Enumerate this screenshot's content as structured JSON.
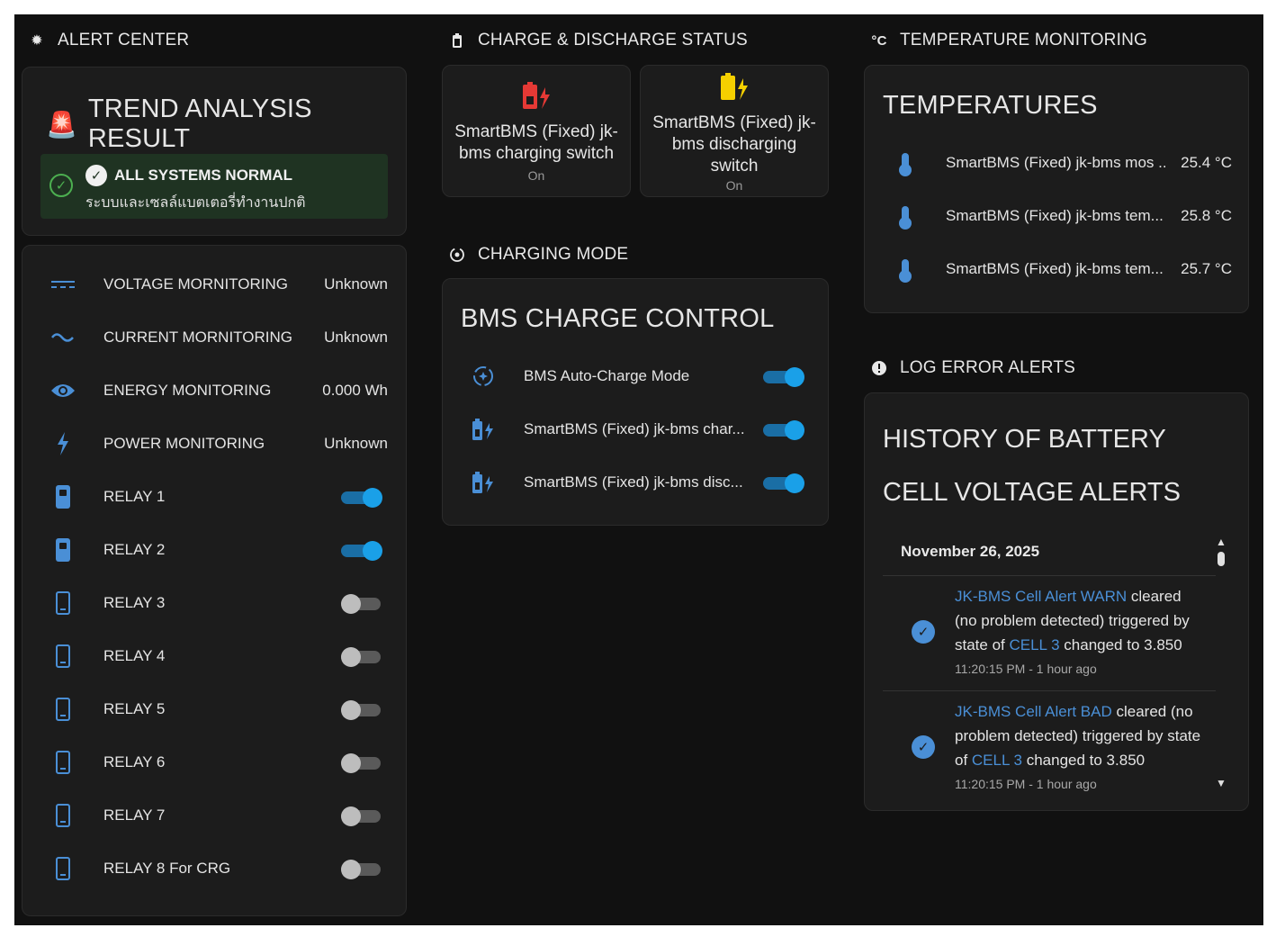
{
  "alert_center": {
    "title": "ALERT CENTER",
    "trend_title": "TREND ANALYSIS RESULT",
    "status_title": "ALL SYSTEMS NORMAL",
    "status_sub": "ระบบและเซลล์แบตเตอรี่ทำงานปกติ",
    "status_color": "#1f3322",
    "monitors": [
      {
        "label": "VOLTAGE MORNITORING",
        "value": "Unknown",
        "icon": "voltage-icon"
      },
      {
        "label": "CURRENT MORNITORING",
        "value": "Unknown",
        "icon": "current-icon"
      },
      {
        "label": "ENERGY MONITORING",
        "value": "0.000 Wh",
        "icon": "eye-icon"
      },
      {
        "label": "POWER MONITORING",
        "value": "Unknown",
        "icon": "lightning-icon"
      }
    ],
    "relays": [
      {
        "label": "RELAY 1",
        "on": true
      },
      {
        "label": "RELAY 2",
        "on": true
      },
      {
        "label": "RELAY 3",
        "on": false
      },
      {
        "label": "RELAY 4",
        "on": false
      },
      {
        "label": "RELAY 5",
        "on": false
      },
      {
        "label": "RELAY 6",
        "on": false
      },
      {
        "label": "RELAY 7",
        "on": false
      },
      {
        "label": "RELAY 8 For CRG",
        "on": false
      }
    ]
  },
  "charge_status": {
    "title": "CHARGE & DISCHARGE STATUS",
    "tiles": [
      {
        "name": "SmartBMS (Fixed) jk-bms charging switch",
        "state": "On",
        "icon": "battery-charging-icon",
        "color": "#e53935"
      },
      {
        "name": "SmartBMS (Fixed) jk-bms discharging switch",
        "state": "On",
        "icon": "battery-discharging-icon",
        "color": "#f5d000"
      }
    ]
  },
  "charging_mode": {
    "title": "CHARGING MODE",
    "card_title": "BMS CHARGE CONTROL",
    "rows": [
      {
        "label": "BMS Auto-Charge Mode",
        "icon": "auto-mode-icon",
        "on": true
      },
      {
        "label": "SmartBMS (Fixed) jk-bms char...",
        "icon": "battery-charging-icon",
        "on": true
      },
      {
        "label": "SmartBMS (Fixed) jk-bms disc...",
        "icon": "battery-charging-icon",
        "on": true
      }
    ]
  },
  "temperature": {
    "title": "TEMPERATURE MONITORING",
    "title_icon": "°C",
    "card_title": "TEMPERATURES",
    "rows": [
      {
        "label": "SmartBMS (Fixed) jk-bms mos ...",
        "value": "25.4 °C"
      },
      {
        "label": "SmartBMS (Fixed) jk-bms tem...",
        "value": "25.8 °C"
      },
      {
        "label": "SmartBMS (Fixed) jk-bms tem...",
        "value": "25.7 °C"
      }
    ]
  },
  "log_alerts": {
    "title": "LOG ERROR ALERTS",
    "card_title": "HISTORY OF BATTERY CELL VOLTAGE ALERTS",
    "date": "November 26, 2025",
    "entries": [
      {
        "entity": "JK-BMS Cell Alert WARN",
        "text1": " cleared (no problem detected) triggered by state of ",
        "cell": "CELL 3",
        "text2": " changed to 3.850",
        "time": "11:20:15 PM - 1 hour ago"
      },
      {
        "entity": "JK-BMS Cell Alert BAD",
        "text1": " cleared (no problem detected) triggered by state of ",
        "cell": "CELL 3",
        "text2": " changed to 3.850",
        "time": "11:20:15 PM - 1 hour ago"
      }
    ]
  },
  "colors": {
    "accent": "#4a8fd6",
    "toggle_on": "#1aa0e8",
    "background": "#111111",
    "card": "#1c1c1c"
  }
}
